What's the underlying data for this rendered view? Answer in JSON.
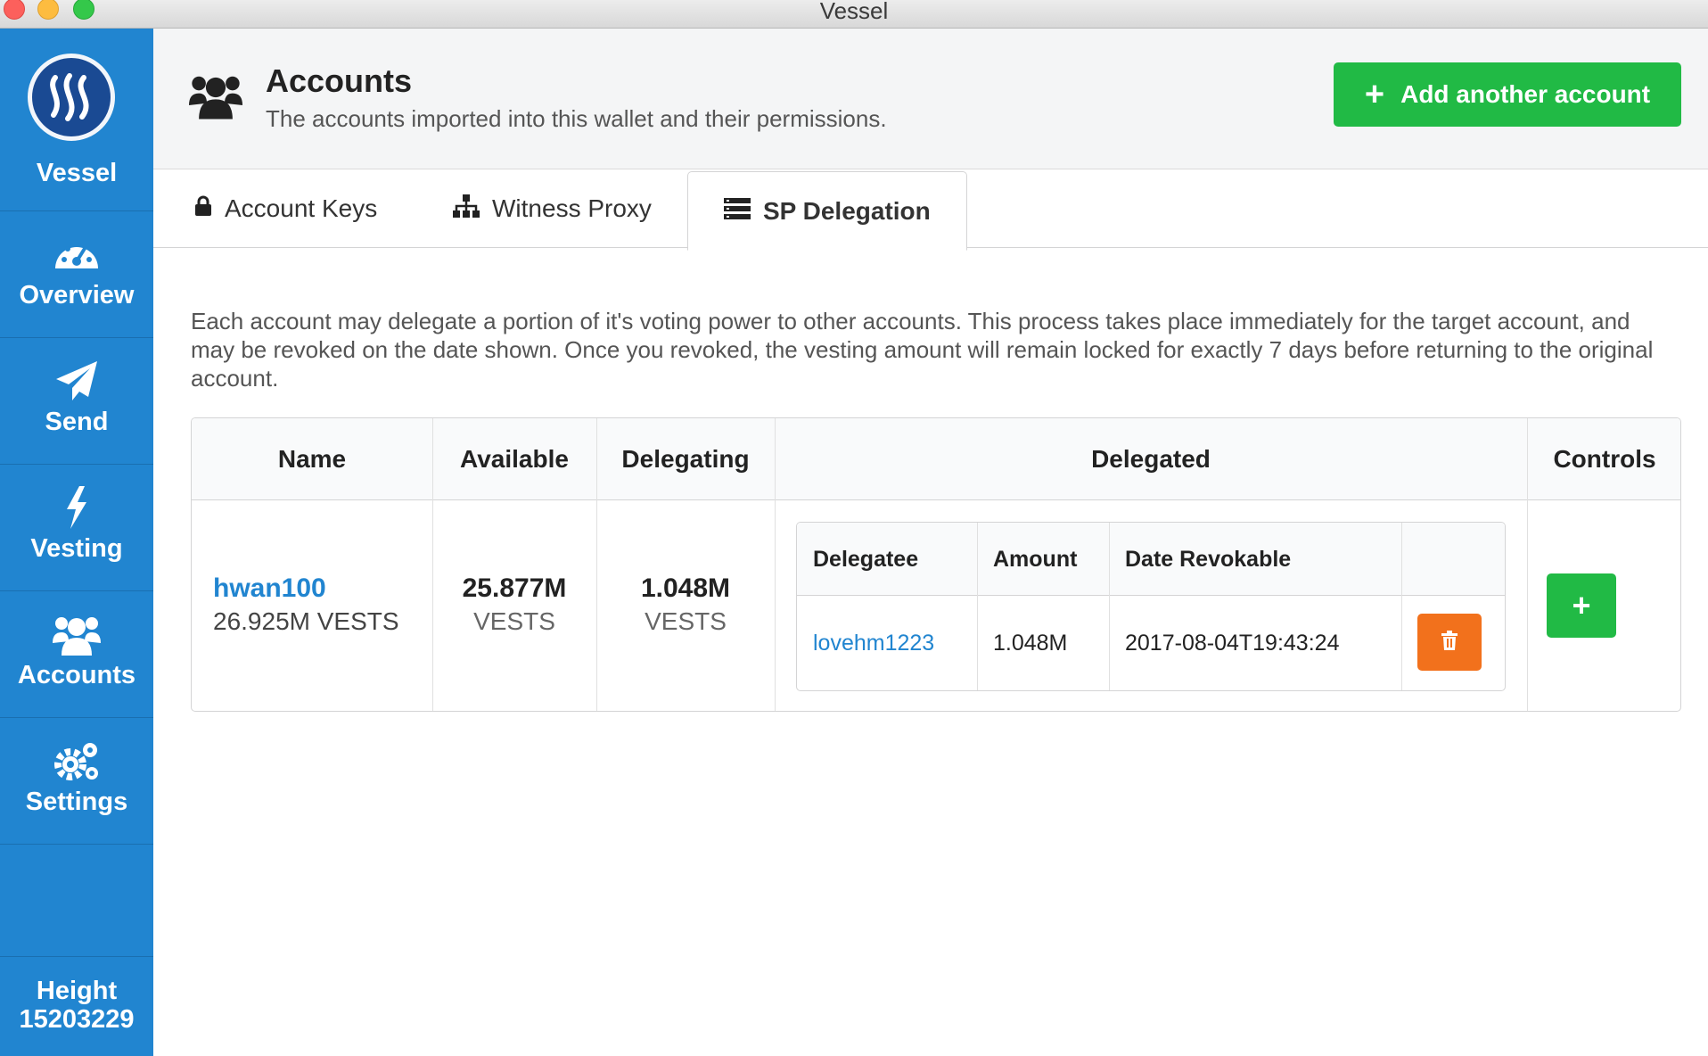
{
  "window": {
    "title": "Vessel"
  },
  "sidebar": {
    "brand": "Vessel",
    "items": [
      {
        "label": "Overview",
        "icon": "dashboard-icon"
      },
      {
        "label": "Send",
        "icon": "paper-plane-icon"
      },
      {
        "label": "Vesting",
        "icon": "lightning-icon"
      },
      {
        "label": "Accounts",
        "icon": "users-icon"
      },
      {
        "label": "Settings",
        "icon": "gears-icon"
      }
    ],
    "height_label": "Height",
    "height_value": "15203229"
  },
  "header": {
    "title": "Accounts",
    "subtitle": "The accounts imported into this wallet and their permissions.",
    "add_button": "Add another account"
  },
  "tabs": [
    {
      "label": "Account Keys",
      "icon": "lock-icon"
    },
    {
      "label": "Witness Proxy",
      "icon": "sitemap-icon"
    },
    {
      "label": "SP Delegation",
      "icon": "list-icon",
      "active": true
    }
  ],
  "description": "Each account may delegate a portion of it's voting power to other accounts. This process takes place immediately for the target account, and may be revoked on the date shown. Once you revoked, the vesting amount will remain locked for exactly 7 days before returning to the original account.",
  "table": {
    "headers": [
      "Name",
      "Available",
      "Delegating",
      "Delegated",
      "Controls"
    ],
    "row": {
      "name": "hwan100",
      "name_vests": "26.925M VESTS",
      "available": "25.877M",
      "available_unit": "VESTS",
      "delegating": "1.048M",
      "delegating_unit": "VESTS"
    },
    "inner_headers": [
      "Delegatee",
      "Amount",
      "Date Revokable"
    ],
    "inner_row": {
      "delegatee": "lovehm1223",
      "amount": "1.048M",
      "date": "2017-08-04T19:43:24"
    }
  },
  "colors": {
    "sidebar": "#2185d0",
    "green": "#21ba45",
    "orange": "#f2711c",
    "link": "#2185d0"
  }
}
